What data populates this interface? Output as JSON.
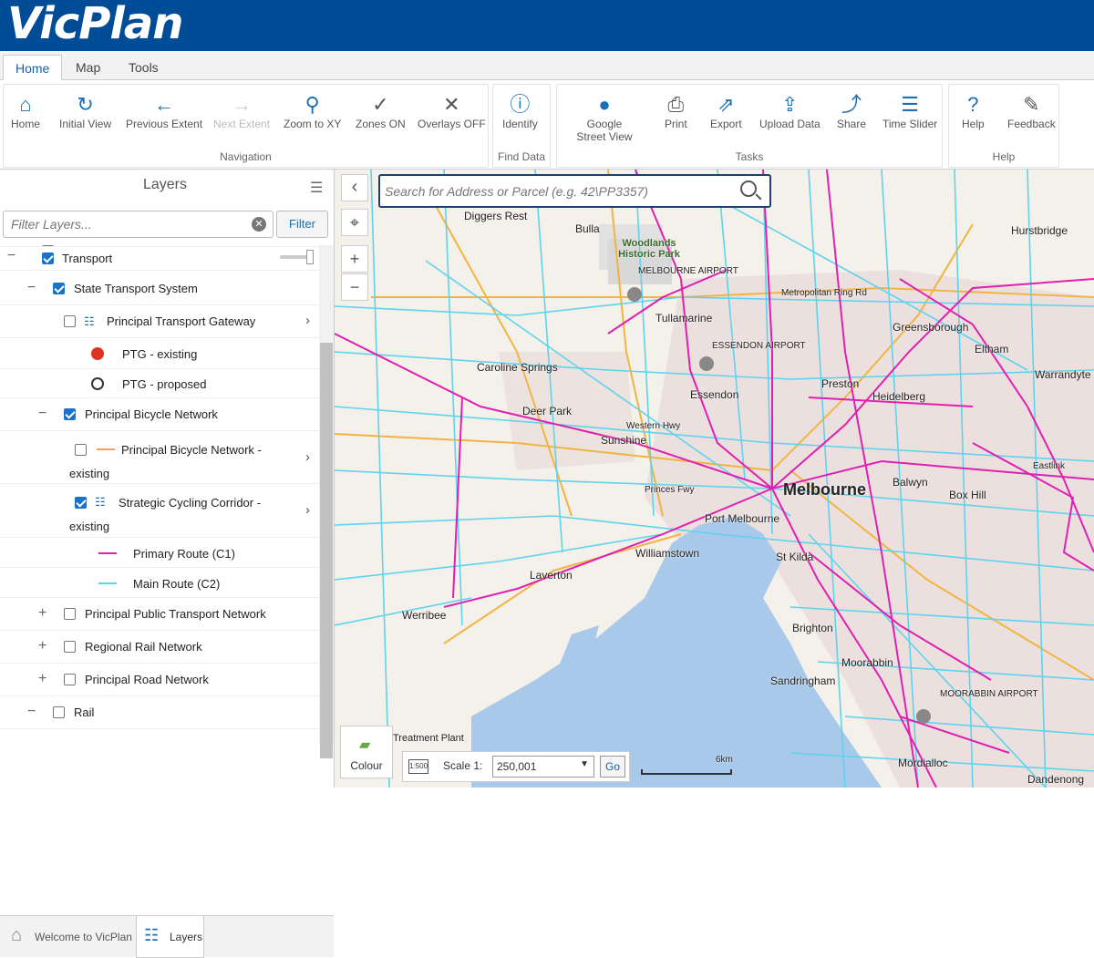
{
  "app": {
    "logo": "VicPlan"
  },
  "tabs": [
    {
      "label": "Home"
    },
    {
      "label": "Map"
    },
    {
      "label": "Tools"
    }
  ],
  "ribbon": {
    "navigation": {
      "title": "Navigation",
      "buttons": [
        {
          "label": "Home",
          "icon": "home-icon"
        },
        {
          "label": "Initial View",
          "icon": "refresh-icon"
        },
        {
          "label": "Previous Extent",
          "icon": "back-arrow-icon"
        },
        {
          "label": "Next Extent",
          "icon": "forward-arrow-icon"
        },
        {
          "label": "Zoom to XY",
          "icon": "pin-icon"
        },
        {
          "label": "Zones ON",
          "icon": "check-icon"
        },
        {
          "label": "Overlays OFF",
          "icon": "x-icon"
        }
      ]
    },
    "find": {
      "title": "Find Data",
      "buttons": [
        {
          "label": "Identify",
          "icon": "identify-icon"
        }
      ]
    },
    "tasks": {
      "title": "Tasks",
      "buttons": [
        {
          "label": "Google Street View",
          "icon": "street-view-icon"
        },
        {
          "label": "Print",
          "icon": "printer-icon"
        },
        {
          "label": "Export",
          "icon": "export-icon"
        },
        {
          "label": "Upload Data",
          "icon": "upload-icon"
        },
        {
          "label": "Share",
          "icon": "share-icon"
        },
        {
          "label": "Time Slider",
          "icon": "slider-icon"
        }
      ]
    },
    "help": {
      "title": "Help",
      "buttons": [
        {
          "label": "Help",
          "icon": "help-icon"
        },
        {
          "label": "Feedback",
          "icon": "feedback-icon"
        }
      ]
    }
  },
  "layers": {
    "title": "Layers",
    "filter_placeholder": "Filter Layers...",
    "filter_button": "Filter",
    "items": [
      {
        "label": "Transport",
        "checked": true
      },
      {
        "label": "State Transport System",
        "checked": true
      },
      {
        "label": "Principal Transport Gateway",
        "checked": false
      },
      {
        "label": "PTG - existing"
      },
      {
        "label": "PTG - proposed"
      },
      {
        "label": "Principal Bicycle Network",
        "checked": true
      },
      {
        "label": "Principal Bicycle Network -",
        "label2": "existing",
        "checked": false
      },
      {
        "label": "Strategic Cycling Corridor -",
        "label2": "existing",
        "checked": true
      },
      {
        "label": "Primary Route (C1)",
        "color": "#e020b0"
      },
      {
        "label": "Main Route (C2)",
        "color": "#5fd3ee"
      },
      {
        "label": "Principal Public Transport Network",
        "checked": false
      },
      {
        "label": "Regional Rail Network",
        "checked": false
      },
      {
        "label": "Principal Road Network",
        "checked": false
      },
      {
        "label": "Rail",
        "checked": false
      }
    ]
  },
  "bottom_tabs": [
    {
      "label": "Welcome to VicPlan"
    },
    {
      "label": "Layers"
    }
  ],
  "map": {
    "search_placeholder": "Search for Address or Parcel (e.g. 42\\PP3357)",
    "places": [
      "Diggers Rest",
      "Bulla",
      "Woodlands Historic Park",
      "MELBOURNE AIRPORT",
      "Tullamarine",
      "ESSENDON AIRPORT",
      "Caroline Springs",
      "Deer Park",
      "Melbourne",
      "Port Melbourne",
      "Williamstown",
      "Laverton",
      "Werribee",
      "St Kilda",
      "Brighton",
      "Moorabbin",
      "MOORABBIN AIRPORT",
      "Sandringham",
      "Mordialloc",
      "Greensborough",
      "Eltham",
      "Heidelberg",
      "Preston",
      "Essendon",
      "Sunshine",
      "Balwyn",
      "Box Hill",
      "Hurstbridge",
      "Warrandyte",
      "Dandenong",
      "Treatment Plant"
    ],
    "roads": [
      "Metropolitan Ring Rd",
      "Western Hwy",
      "Princes Fwy",
      "Eastlink"
    ],
    "colour_button": "Colour",
    "scale_label": "Scale 1:",
    "scale_value": "250,001",
    "go_button": "Go",
    "scalebar": "6km",
    "colors": {
      "primary_route": "#e020b0",
      "main_route": "#5fd3ee",
      "water": "#a9c9ea",
      "arterial": "#f2b441"
    }
  }
}
